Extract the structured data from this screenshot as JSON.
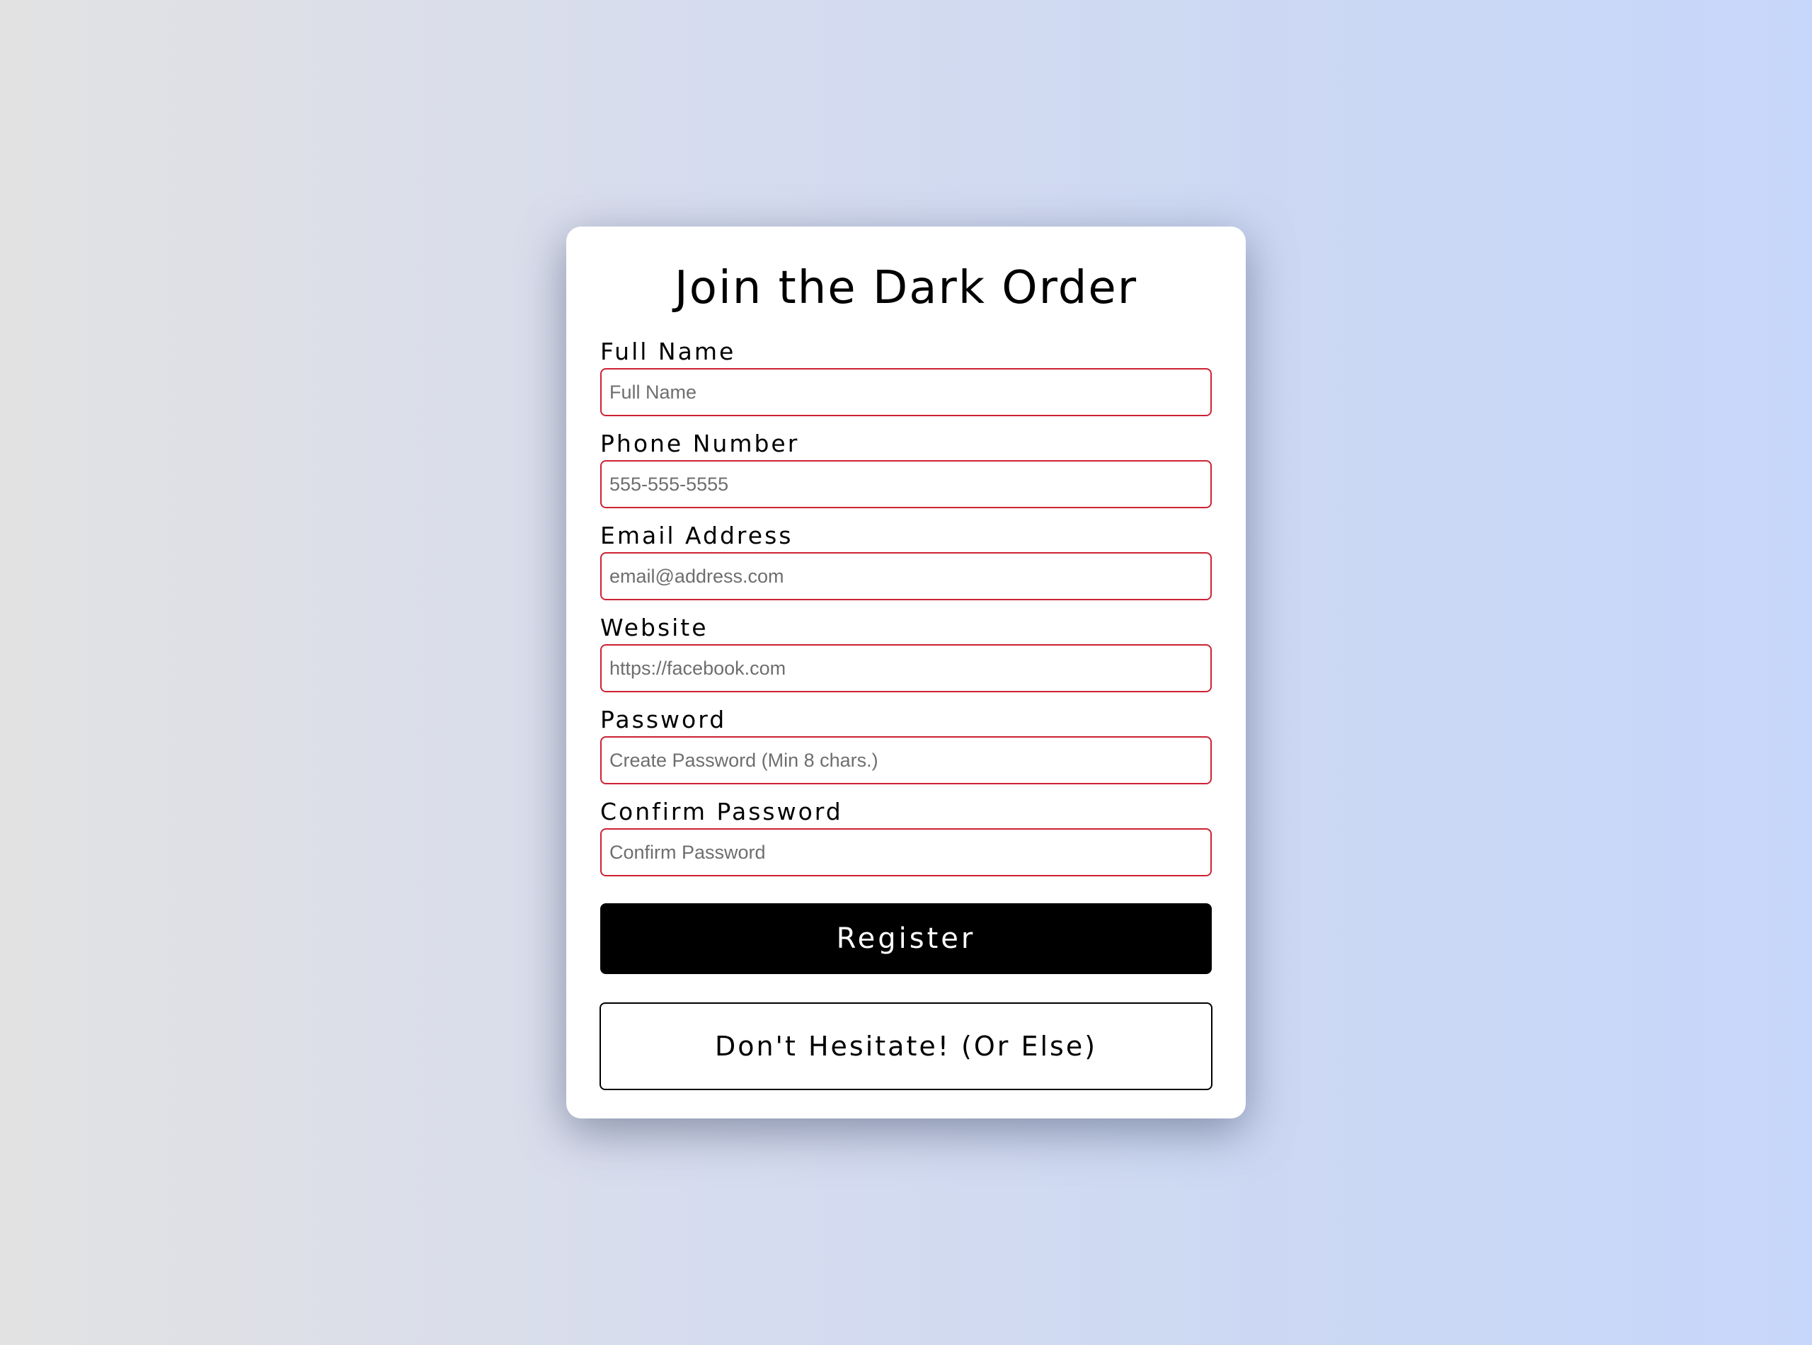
{
  "form": {
    "title": "Join the Dark Order",
    "fields": [
      {
        "label": "Full Name",
        "placeholder": "Full Name",
        "value": ""
      },
      {
        "label": "Phone Number",
        "placeholder": "555-555-5555",
        "value": ""
      },
      {
        "label": "Email Address",
        "placeholder": "email@address.com",
        "value": ""
      },
      {
        "label": "Website",
        "placeholder": "https://facebook.com",
        "value": ""
      },
      {
        "label": "Password",
        "placeholder": "Create Password (Min 8 chars.)",
        "value": ""
      },
      {
        "label": "Confirm Password",
        "placeholder": "Confirm Password",
        "value": ""
      }
    ],
    "register_label": "Register",
    "hesitate_label": "Don't Hesitate! (Or Else)"
  },
  "colors": {
    "input_border": "#cc2233",
    "register_bg": "#000000",
    "register_text": "#ffffff",
    "card_bg": "#ffffff"
  }
}
